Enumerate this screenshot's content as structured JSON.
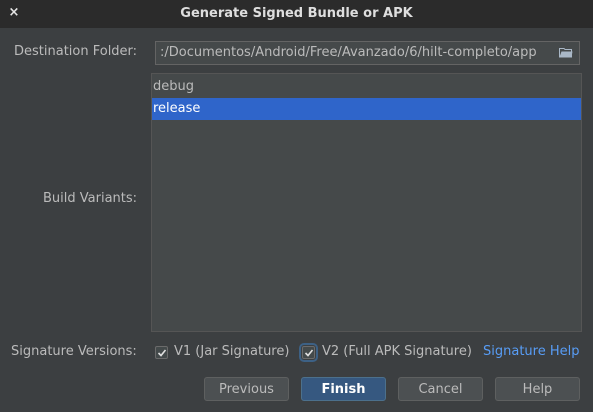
{
  "window": {
    "title": "Generate Signed Bundle or APK",
    "close_glyph": "×"
  },
  "destination": {
    "label": "Destination Folder:",
    "value": ":/Documentos/Android/Free/Avanzado/6/hilt-completo/app",
    "icon": "folder-icon"
  },
  "build_variants": {
    "label": "Build Variants:",
    "items": [
      {
        "label": "debug",
        "selected": false
      },
      {
        "label": "release",
        "selected": true
      }
    ]
  },
  "signature": {
    "label": "Signature Versions:",
    "v1": {
      "label": "V1 (Jar Signature)",
      "checked": true
    },
    "v2": {
      "label": "V2 (Full APK Signature)",
      "checked": true
    },
    "help_link": "Signature Help"
  },
  "buttons": {
    "previous": "Previous",
    "finish": "Finish",
    "cancel": "Cancel",
    "help": "Help"
  },
  "colors": {
    "background": "#3c3f41",
    "titlebar": "#2b2b2b",
    "selection": "#2f65ca",
    "link": "#589df6",
    "default_button": "#365880"
  }
}
